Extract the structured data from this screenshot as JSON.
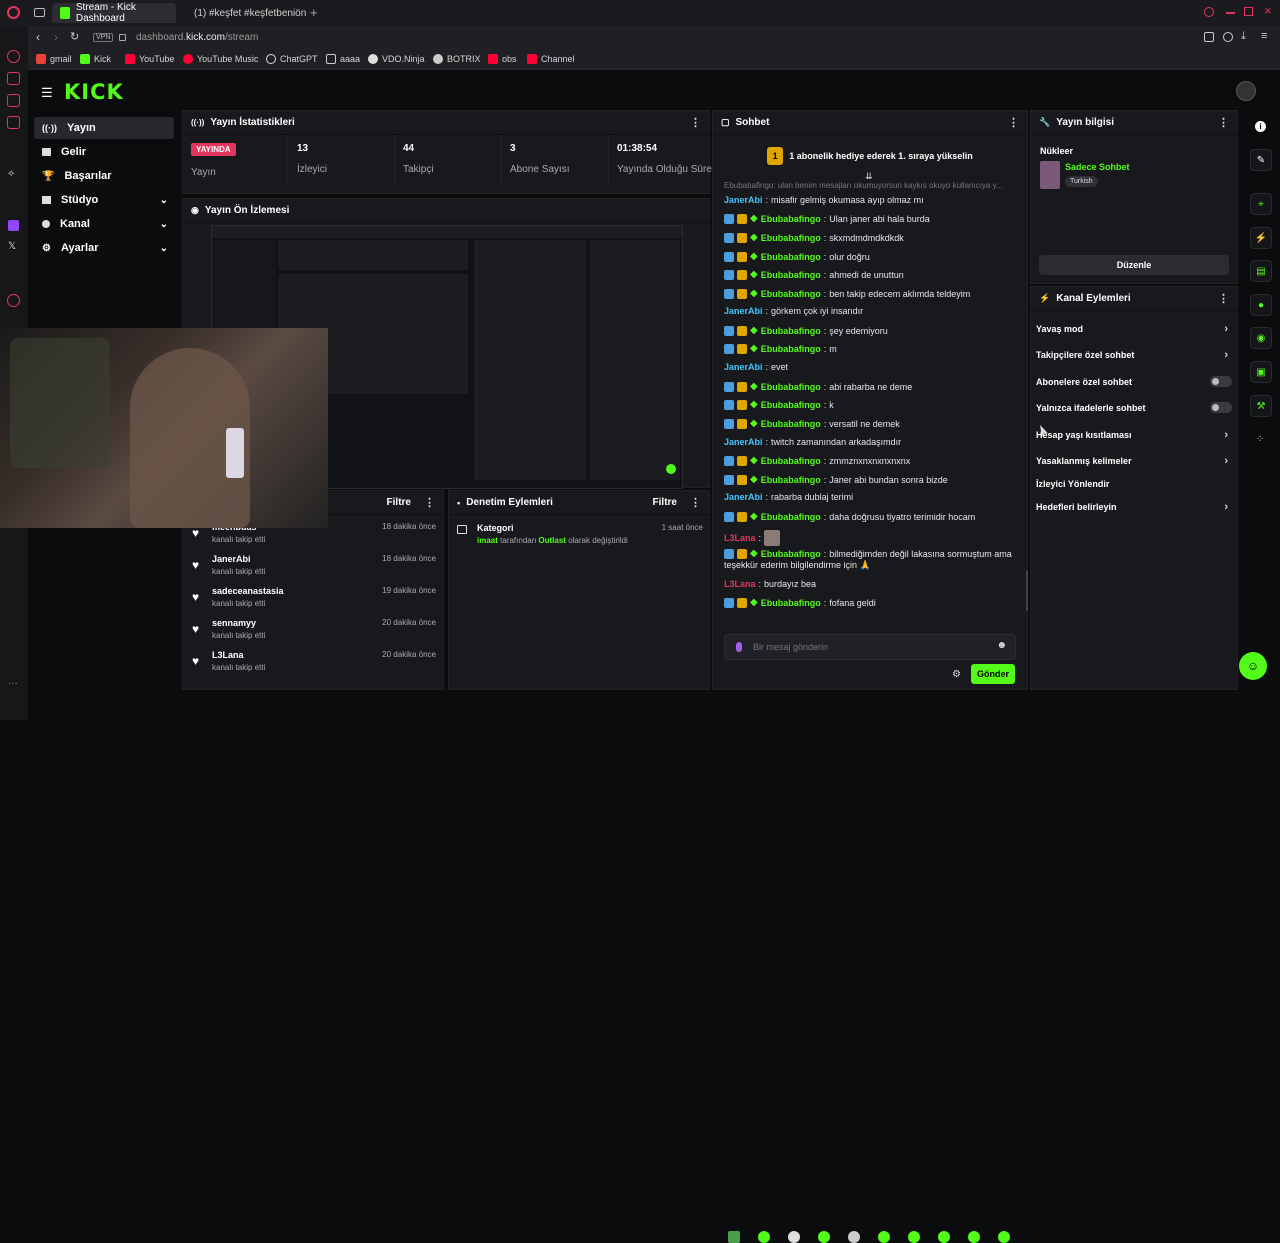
{
  "browser": {
    "tabs": [
      {
        "label": "Stream - Kick Dashboard"
      },
      {
        "label": "(1) #keşfet #keşfetbeniöne"
      }
    ],
    "address_prefix": "dashboard.",
    "address_domain": "kick.com",
    "address_path": "/stream",
    "vpn": "VPN",
    "bookmarks": [
      "gmail",
      "Kick",
      "YouTube",
      "YouTube Music",
      "ChatGPT",
      "aaaa",
      "VDO.Ninja",
      "BOTRIX",
      "obs",
      "Channel"
    ]
  },
  "brand": {
    "logo": "KICK",
    "accent": "#53fc18"
  },
  "sidebar": {
    "items": [
      {
        "label": "Yayın",
        "icon": "broadcast-icon"
      },
      {
        "label": "Gelir",
        "icon": "wallet-icon"
      },
      {
        "label": "Başarılar",
        "icon": "trophy-icon"
      },
      {
        "label": "Stüdyo",
        "icon": "video-icon"
      },
      {
        "label": "Kanal",
        "icon": "user-icon"
      },
      {
        "label": "Ayarlar",
        "icon": "gear-icon"
      }
    ]
  },
  "stats": {
    "title": "Yayın İstatistikleri",
    "live_badge": "YAYINDA",
    "live_label": "Yayın",
    "items": [
      {
        "value": "13",
        "label": "İzleyici"
      },
      {
        "value": "44",
        "label": "Takipçi"
      },
      {
        "value": "3",
        "label": "Abone Sayısı"
      },
      {
        "value": "01:38:54",
        "label": "Yayında Olduğu Süre"
      }
    ]
  },
  "preview": {
    "title": "Yayın Ön İzlemesi"
  },
  "follows": {
    "filter": "Filtre",
    "items": [
      {
        "name": "meenbuas",
        "sub": "kanalı takip etti",
        "time": "18 dakika önce"
      },
      {
        "name": "JanerAbi",
        "sub": "kanalı takip etti",
        "time": "18 dakika önce"
      },
      {
        "name": "sadeceanastasia",
        "sub": "kanalı takip etti",
        "time": "19 dakika önce"
      },
      {
        "name": "sennamyy",
        "sub": "kanalı takip etti",
        "time": "20 dakika önce"
      },
      {
        "name": "L3Lana",
        "sub": "kanalı takip etti",
        "time": "20 dakika önce"
      }
    ]
  },
  "moderation": {
    "title": "Denetim Eylemleri",
    "filter": "Filtre",
    "item_title": "Kategori",
    "item_time": "1 saat önce",
    "item_user": "imaat",
    "item_mid": "tarafından",
    "item_cat": "Outlast",
    "item_end": "olarak değiştirildi"
  },
  "chat": {
    "title": "Sohbet",
    "pinned": "1 abonelik hediye ederek 1. sıraya yükselin",
    "partial": "Ebubabafingo: ulan benim mesajları okumuyorsun kaykıs okuyo kullanıcıya y...",
    "messages": [
      {
        "user": "JanerAbi",
        "text": "misafir gelmiş okumasa ayıp olmaz mı",
        "kind": "janer"
      },
      {
        "user": "Ebubabafingo",
        "text": "Ulan janer abi hala burda",
        "kind": "ebu"
      },
      {
        "user": "Ebubabafingo",
        "text": "skxmdmdmdkdkdk",
        "kind": "ebu"
      },
      {
        "user": "Ebubabafingo",
        "text": "olur doğru",
        "kind": "ebu"
      },
      {
        "user": "Ebubabafingo",
        "text": "ahmedi de unuttun",
        "kind": "ebu"
      },
      {
        "user": "Ebubabafingo",
        "text": "ben takip edecem aklımda teldeyim",
        "kind": "ebu"
      },
      {
        "user": "JanerAbi",
        "text": "görkem çok iyi insandır",
        "kind": "janer"
      },
      {
        "user": "Ebubabafingo",
        "text": "şey edemiyoru",
        "kind": "ebu"
      },
      {
        "user": "Ebubabafingo",
        "text": "m",
        "kind": "ebu"
      },
      {
        "user": "JanerAbi",
        "text": "evet",
        "kind": "janer"
      },
      {
        "user": "Ebubabafingo",
        "text": "abi rabarba ne deme",
        "kind": "ebu"
      },
      {
        "user": "Ebubabafingo",
        "text": "k",
        "kind": "ebu"
      },
      {
        "user": "Ebubabafingo",
        "text": "versatil ne demek",
        "kind": "ebu"
      },
      {
        "user": "JanerAbi",
        "text": "twitch zamanından arkadaşımdır",
        "kind": "janer"
      },
      {
        "user": "Ebubabafingo",
        "text": "zmmznxnxnxnxnxnx",
        "kind": "ebu"
      },
      {
        "user": "Ebubabafingo",
        "text": "Janer abi bundan sonra bizde",
        "kind": "ebu"
      },
      {
        "user": "JanerAbi",
        "text": "rabarba dublaj terimi",
        "kind": "janer"
      },
      {
        "user": "Ebubabafingo",
        "text": "daha doğrusu tiyatro terimidir hocam",
        "kind": "ebu"
      },
      {
        "user": "L3Lana",
        "text": "",
        "kind": "lana"
      },
      {
        "user": "Ebubabafingo",
        "text": "bilmediğimden değil lakasına sormuştum ama",
        "kind": "ebu"
      },
      {
        "user": "",
        "text": "teşekkür ederim bilgilendirme için 🙏",
        "kind": "cont"
      },
      {
        "user": "L3Lana",
        "text": "burdayız bea",
        "kind": "lana"
      },
      {
        "user": "Ebubabafingo",
        "text": "fofana geldi",
        "kind": "ebu"
      }
    ],
    "input_placeholder": "Bir mesaj gönderin",
    "send": "Gönder"
  },
  "stream_info": {
    "title": "Yayın bilgisi",
    "nukleer": "Nükleer",
    "channel": "Sadece Sohbet",
    "tag": "Turkish",
    "edit": "Düzenle"
  },
  "channel_actions": {
    "title": "Kanal Eylemleri",
    "items": [
      {
        "label": "Yavaş mod",
        "control": "chevron"
      },
      {
        "label": "Takipçilere özel sohbet",
        "control": "chevron"
      },
      {
        "label": "Abonelere özel sohbet",
        "control": "toggle"
      },
      {
        "label": "Yalnızca ifadelerle sohbet",
        "control": "toggle"
      },
      {
        "label": "Hesap yaşı kısıtlaması",
        "control": "chevron"
      },
      {
        "label": "Yasaklanmış kelimeler",
        "control": "chevron"
      },
      {
        "label": "İzleyici Yönlendir",
        "control": "none"
      },
      {
        "label": "Hedefleri belirleyin",
        "control": "chevron"
      }
    ]
  }
}
